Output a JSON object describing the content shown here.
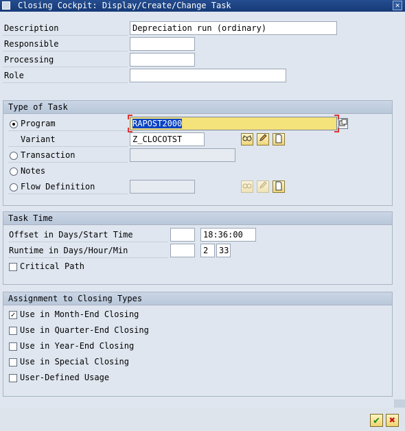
{
  "window": {
    "title": "Closing Cockpit: Display/Create/Change Task",
    "close_symbol": "✕"
  },
  "header_fields": {
    "description_label": "Description",
    "description_value": "Depreciation run (ordinary)",
    "responsible_label": "Responsible",
    "responsible_value": "",
    "processing_label": "Processing",
    "processing_value": "",
    "role_label": "Role",
    "role_value": ""
  },
  "type_of_task": {
    "header": "Type of Task",
    "program_label": "Program",
    "program_value": "RAPOST2000",
    "variant_label": "Variant",
    "variant_value": "Z_CLOCOTST",
    "transaction_label": "Transaction",
    "transaction_value": "",
    "notes_label": "Notes",
    "flow_label": "Flow Definition",
    "flow_value": "",
    "selected": "program"
  },
  "task_time": {
    "header": "Task Time",
    "offset_label": "Offset in Days/Start Time",
    "offset_days": "",
    "start_time": "18:36:00",
    "runtime_label": "Runtime in Days/Hour/Min",
    "runtime_days": "",
    "runtime_hours": "2",
    "runtime_minutes": "33",
    "critical_label": "Critical Path",
    "critical_checked": false
  },
  "assignment": {
    "header": "Assignment to Closing Types",
    "items": [
      {
        "label": "Use in Month-End Closing",
        "checked": true
      },
      {
        "label": "Use in Quarter-End Closing",
        "checked": false
      },
      {
        "label": "Use in Year-End Closing",
        "checked": false
      },
      {
        "label": "Use in Special Closing",
        "checked": false
      },
      {
        "label": "User-Defined Usage",
        "checked": false
      }
    ]
  },
  "icons": {
    "display": "glasses-icon",
    "change": "pencil-icon",
    "create": "new-document-icon",
    "possible_entries": "copy-icon",
    "confirm": "checkmark-icon",
    "cancel": "cancel-icon"
  },
  "footer": {
    "confirm_symbol": "✔",
    "cancel_symbol": "✖"
  },
  "colors": {
    "titlebar": "#1e4487",
    "focused_field": "#f4e27a",
    "selection": "#0a44c4"
  }
}
